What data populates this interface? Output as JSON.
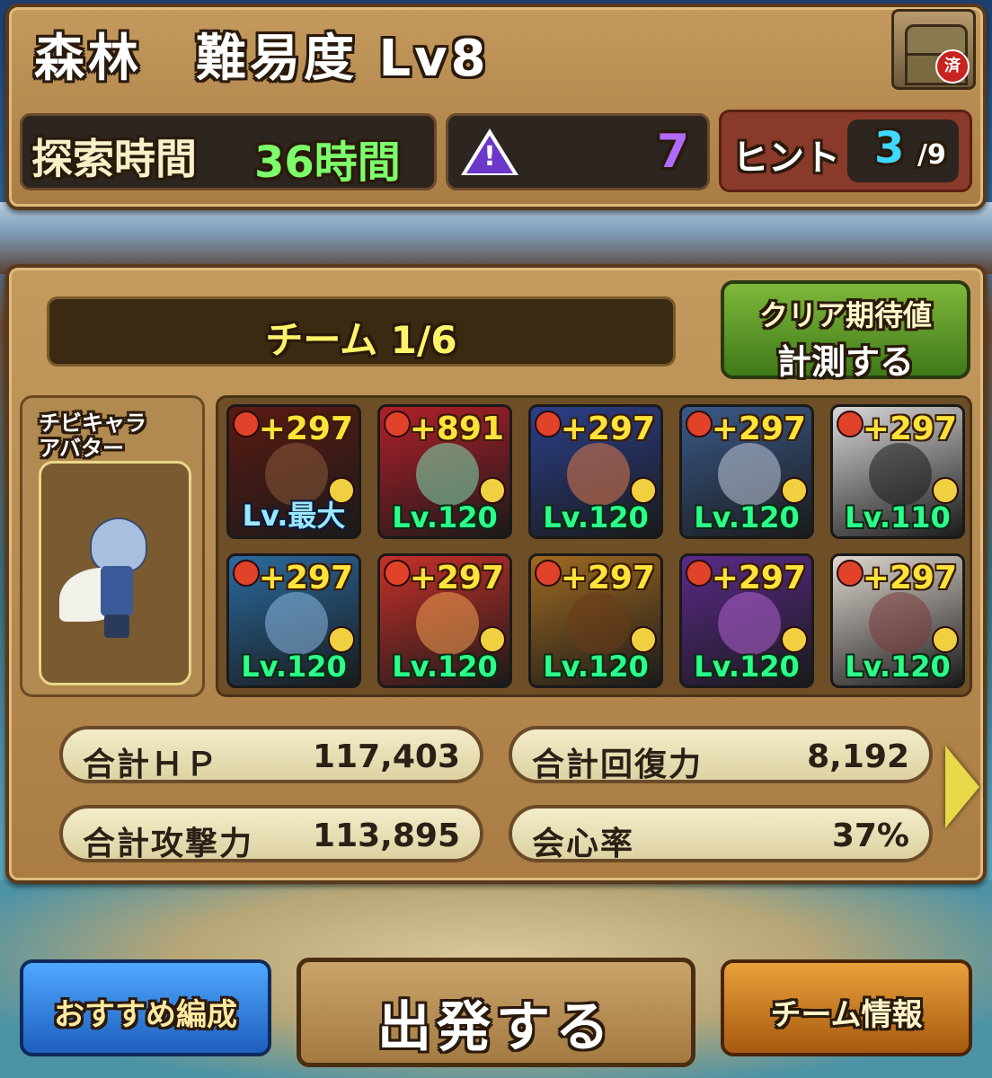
{
  "header": {
    "title": "森林　難易度 Lv8",
    "chest_badge": "済",
    "explore_label": "探索時間",
    "explore_value": "36時間",
    "warning_count": "7",
    "hint_label": "ヒント",
    "hint_value": "3",
    "hint_total": "/9"
  },
  "team": {
    "label": "チーム 1/6",
    "clear_button_line1": "クリア期待値",
    "clear_button_line2": "計測する",
    "avatar_label_line1": "チビキャラ",
    "avatar_label_line2": "アバター",
    "units": [
      {
        "plus": "+297",
        "level": "Lv.最大",
        "max": true,
        "bg": "#5b1a12",
        "face": "#8a5a3a"
      },
      {
        "plus": "+891",
        "level": "Lv.120",
        "max": false,
        "bg": "#b31f2a",
        "face": "#7fe0b0"
      },
      {
        "plus": "+297",
        "level": "Lv.120",
        "max": false,
        "bg": "#2b3f8a",
        "face": "#e07a4a"
      },
      {
        "plus": "+297",
        "level": "Lv.120",
        "max": false,
        "bg": "#3a5a8a",
        "face": "#c0c8d8"
      },
      {
        "plus": "+297",
        "level": "Lv.110",
        "max": false,
        "bg": "#d8d8d8",
        "face": "#1a1a1a"
      },
      {
        "plus": "+297",
        "level": "Lv.120",
        "max": false,
        "bg": "#2a6aa0",
        "face": "#8ab8e0"
      },
      {
        "plus": "+297",
        "level": "Lv.120",
        "max": false,
        "bg": "#c8302a",
        "face": "#f0a050"
      },
      {
        "plus": "+297",
        "level": "Lv.120",
        "max": false,
        "bg": "#a06a20",
        "face": "#6a3a1a"
      },
      {
        "plus": "+297",
        "level": "Lv.120",
        "max": false,
        "bg": "#5a2a8a",
        "face": "#b060d0"
      },
      {
        "plus": "+297",
        "level": "Lv.120",
        "max": false,
        "bg": "#e0d8d0",
        "face": "#7a3a3a"
      }
    ],
    "stats": {
      "hp_label": "合計ＨＰ",
      "hp_value": "117,403",
      "rcv_label": "合計回復力",
      "rcv_value": "8,192",
      "atk_label": "合計攻撃力",
      "atk_value": "113,895",
      "crit_label": "会心率",
      "crit_value": "37%"
    }
  },
  "footer": {
    "recommend_button": "おすすめ編成",
    "depart_button": "出発する",
    "team_info_button": "チーム情報"
  },
  "colors": {
    "explore_value": "#7cff6a",
    "warning_purple": "#6b38c9",
    "hint_value": "#3fd8ff",
    "level_green": "#2bff8a",
    "plus_yellow": "#ffe23a"
  },
  "icons": [
    "treasure-chest-icon",
    "warning-icon",
    "next-arrow-icon"
  ]
}
